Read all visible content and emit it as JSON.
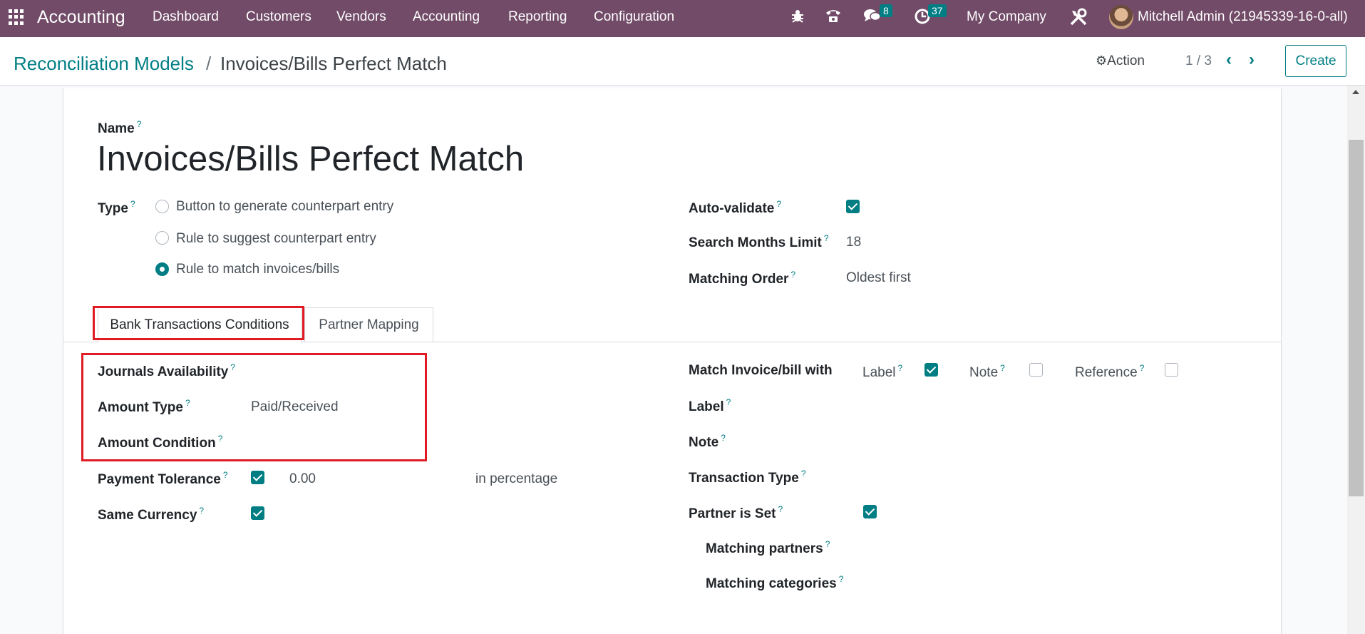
{
  "nav": {
    "app_name": "Accounting",
    "menus": [
      "Dashboard",
      "Customers",
      "Vendors",
      "Accounting",
      "Reporting",
      "Configuration"
    ],
    "messages_count": "8",
    "activities_count": "37",
    "company": "My Company",
    "user": "Mitchell Admin (21945339-16-0-all)"
  },
  "breadcrumb": {
    "parent": "Reconciliation Models",
    "separator": "/",
    "current": "Invoices/Bills Perfect Match"
  },
  "control": {
    "action_label": "Action",
    "pager": "1 / 3",
    "create_label": "Create"
  },
  "form": {
    "name_label": "Name",
    "name_value": "Invoices/Bills Perfect Match",
    "type_label": "Type",
    "type_options": [
      {
        "label": "Button to generate counterpart entry",
        "selected": false
      },
      {
        "label": "Rule to suggest counterpart entry",
        "selected": false
      },
      {
        "label": "Rule to match invoices/bills",
        "selected": true
      }
    ],
    "auto_validate_label": "Auto-validate",
    "auto_validate": true,
    "search_months_label": "Search Months Limit",
    "search_months_value": "18",
    "matching_order_label": "Matching Order",
    "matching_order_value": "Oldest first"
  },
  "tabs": [
    "Bank Transactions Conditions",
    "Partner Mapping"
  ],
  "conditions": {
    "journals_label": "Journals Availability",
    "amount_type_label": "Amount Type",
    "amount_type_value": "Paid/Received",
    "amount_condition_label": "Amount Condition",
    "payment_tolerance_label": "Payment Tolerance",
    "payment_tolerance_checked": true,
    "payment_tolerance_value": "0.00",
    "payment_tolerance_unit": "in percentage",
    "same_currency_label": "Same Currency",
    "same_currency_checked": true,
    "match_with_label": "Match Invoice/bill with",
    "match_label_opt": "Label",
    "match_label_checked": true,
    "match_note_opt": "Note",
    "match_note_checked": false,
    "match_reference_opt": "Reference",
    "match_reference_checked": false,
    "label_label": "Label",
    "note_label": "Note",
    "transaction_type_label": "Transaction Type",
    "partner_set_label": "Partner is Set",
    "partner_set_checked": true,
    "matching_partners_label": "Matching partners",
    "matching_categories_label": "Matching categories"
  },
  "help_mark": "?",
  "colors": {
    "navbar": "#714b67",
    "accent": "#017e84",
    "highlight": "#e01b24"
  }
}
